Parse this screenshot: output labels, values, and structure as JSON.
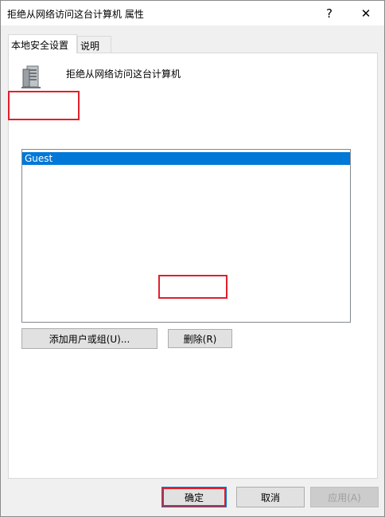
{
  "window": {
    "title": "拒绝从网络访问这台计算机 属性",
    "help_label": "?",
    "close_label": "✕"
  },
  "tabs": [
    {
      "label": "本地安全设置",
      "active": true
    },
    {
      "label": "说明",
      "active": false
    }
  ],
  "panel": {
    "icon": "server-icon",
    "policy_title": "拒绝从网络访问这台计算机",
    "list_items": [
      "Guest"
    ],
    "add_button": "添加用户或组(U)...",
    "remove_button": "删除(R)"
  },
  "footer": {
    "ok_button": "确定",
    "cancel_button": "取消",
    "apply_button": "应用(A)"
  },
  "colors": {
    "selection": "#0078d7",
    "highlight": "#e0202a"
  }
}
